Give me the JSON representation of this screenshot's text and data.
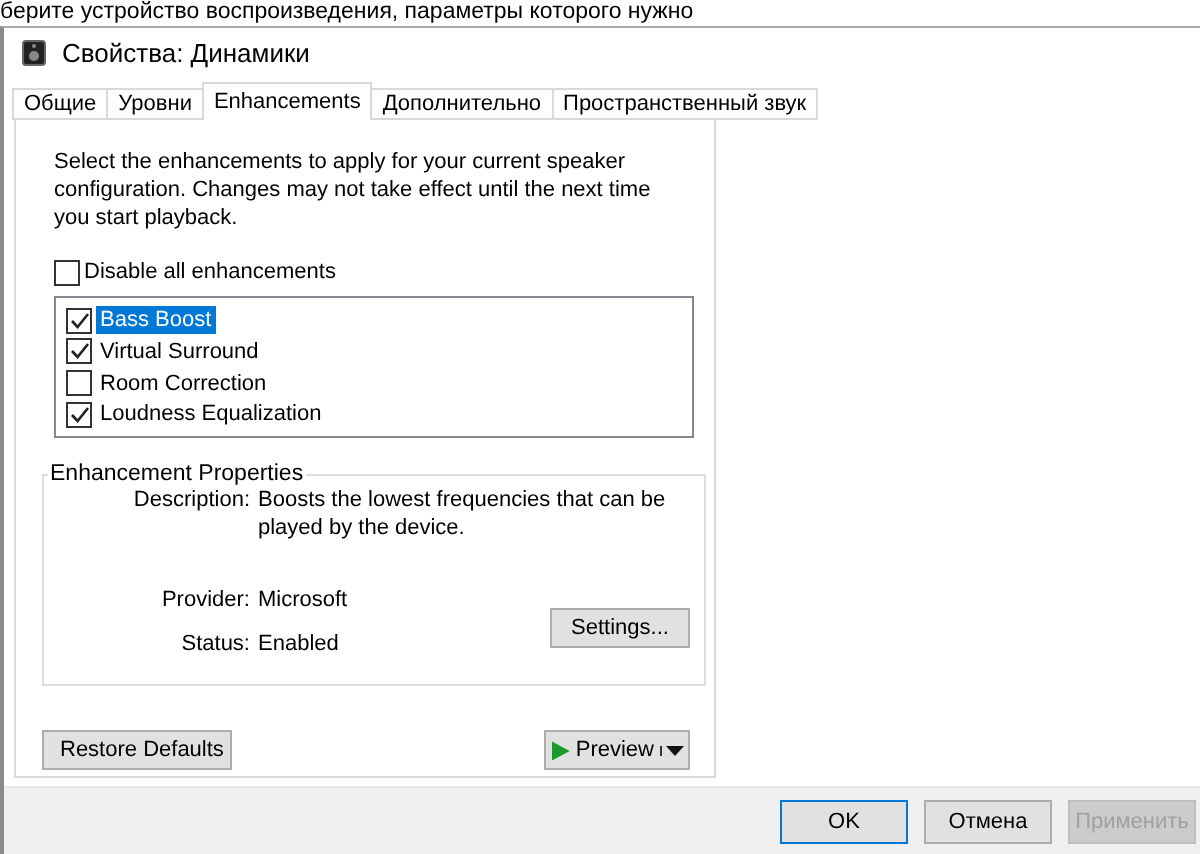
{
  "background_text": "берите устройство воспроизведения, параметры которого нужно",
  "window": {
    "title": "Свойства: Динамики"
  },
  "tabs": [
    {
      "label": "Общие",
      "selected": false
    },
    {
      "label": "Уровни",
      "selected": false
    },
    {
      "label": "Enhancements",
      "selected": true
    },
    {
      "label": "Дополнительно",
      "selected": false
    },
    {
      "label": "Пространственный звук",
      "selected": false
    }
  ],
  "intro": "Select the enhancements to apply for your current speaker configuration. Changes may not take effect until the next time you start playback.",
  "disable_all": {
    "label": "Disable all enhancements",
    "checked": false
  },
  "enhancements": [
    {
      "label": "Bass Boost",
      "checked": true,
      "selected": true
    },
    {
      "label": "Virtual Surround",
      "checked": true,
      "selected": false
    },
    {
      "label": "Room Correction",
      "checked": false,
      "selected": false
    },
    {
      "label": "Loudness Equalization",
      "checked": true,
      "selected": false
    }
  ],
  "properties": {
    "title": "Enhancement Properties",
    "fields": [
      {
        "label": "Description:",
        "value": "Boosts the lowest frequencies that can be played by the device."
      },
      {
        "label": "Provider:",
        "value": "Microsoft"
      },
      {
        "label": "Status:",
        "value": "Enabled"
      }
    ],
    "settings_button": "Settings..."
  },
  "restore_button": "Restore Defaults",
  "preview_button": "Preview",
  "buttons": [
    {
      "label": "OK",
      "default": true,
      "disabled": false
    },
    {
      "label": "Отмена",
      "default": false,
      "disabled": false
    },
    {
      "label": "Применить",
      "default": false,
      "disabled": true
    }
  ]
}
